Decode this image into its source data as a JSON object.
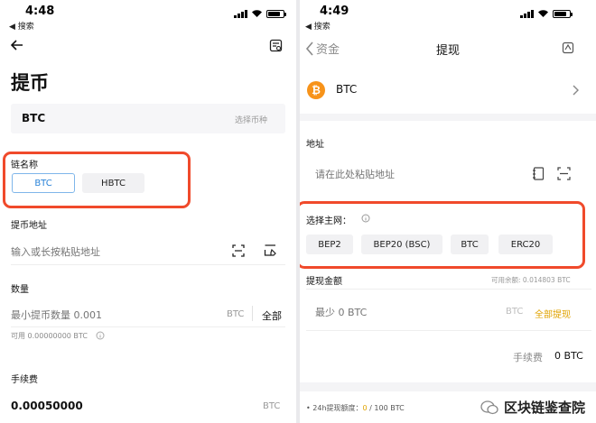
{
  "left": {
    "status": {
      "time": "4:48",
      "back": "◀ 搜索"
    },
    "title": "提币",
    "coin": {
      "name": "BTC",
      "select_label": "选择币种"
    },
    "chain": {
      "label": "链名称",
      "options": [
        "BTC",
        "HBTC"
      ],
      "selected": "BTC"
    },
    "address": {
      "label": "提币地址",
      "placeholder": "输入或长按粘贴地址"
    },
    "amount": {
      "label": "数量",
      "placeholder": "最小提币数量 0.001",
      "unit": "BTC",
      "all": "全部",
      "available": "可用 0.00000000 BTC"
    },
    "fee": {
      "label": "手续费",
      "value": "0.00050000",
      "unit": "BTC"
    }
  },
  "right": {
    "status": {
      "time": "4:49",
      "back": "◀ 搜索"
    },
    "nav": {
      "back_label": "资金",
      "title": "提现"
    },
    "coin": {
      "name": "BTC",
      "symbol": "₿"
    },
    "address": {
      "label": "地址",
      "placeholder": "请在此处粘贴地址"
    },
    "network": {
      "label": "选择主网：",
      "options": [
        "BEP2",
        "BEP20 (BSC)",
        "BTC",
        "ERC20"
      ]
    },
    "withdraw": {
      "label": "提现金额",
      "available": "可用余额: 0.014803 BTC",
      "placeholder": "最少 0 BTC",
      "unit": "BTC",
      "all": "全部提现"
    },
    "fee": {
      "label": "手续费",
      "value": "0 BTC"
    },
    "quota": {
      "prefix": "• 24h提现额度：",
      "used": "0",
      "rest": " / 100 BTC"
    }
  },
  "watermark": {
    "text": "区块链鉴查院"
  },
  "colors": {
    "highlight": "#f04a2b",
    "accent": "#2a83d8",
    "bitcoin": "#f7931a",
    "gold": "#e0a300"
  }
}
